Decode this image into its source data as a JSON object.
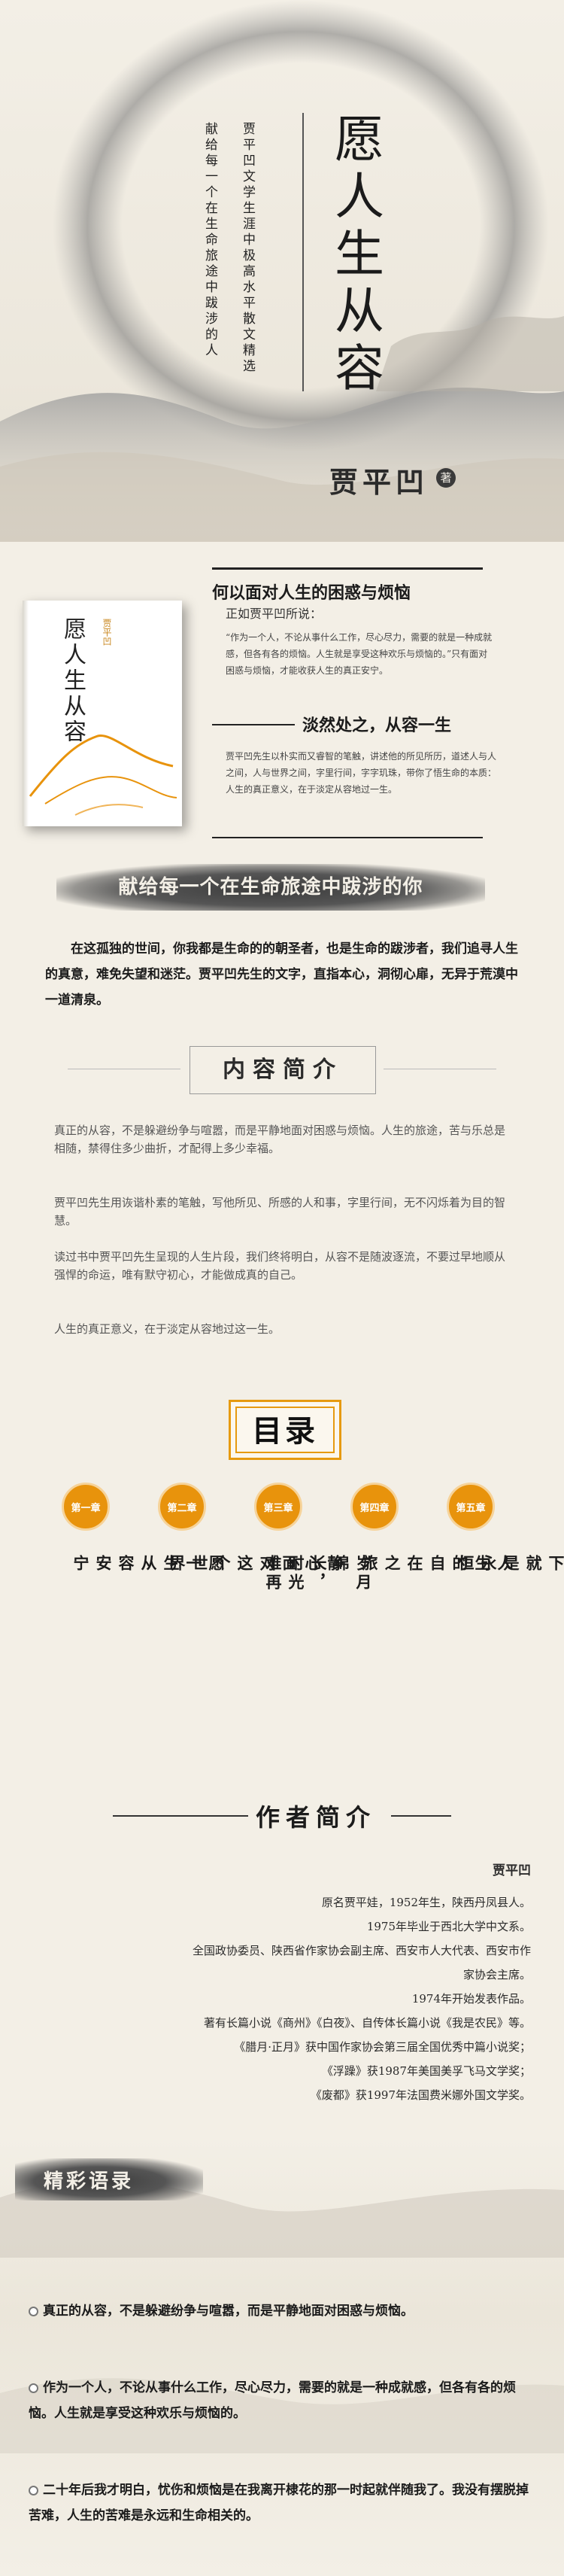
{
  "hero": {
    "title": "愿人生从容",
    "subtitle_1": "贾平凹文学生涯中极高水平散文精选",
    "subtitle_2": "献给每一个在生命旅途中跋涉的人",
    "author": "贾平凹",
    "author_suffix": "著"
  },
  "book": {
    "cover_title": "愿人生从容",
    "cover_author": "贾平凹",
    "question_title": "何以面对人生的困惑与烦恼",
    "question_sub": "正如贾平凹所说：",
    "quote_text": "“作为一个人，不论从事什么工作，尽心尽力，需要的就是一种成就感，但各有各的烦恼。人生就是享受这种欢乐与烦恼的。”只有面对困惑与烦恼，才能收获人生的真正安宁。",
    "answer_title": "淡然处之，从容一生",
    "answer_text": "贾平凹先生以朴实而又睿智的笔触，讲述他的所见所历，道述人与人之间，人与世界之间，字里行间，字字玑珠，带你了悟生命的本质：人生的真正意义，在于淡定从容地过一生。"
  },
  "dedication": {
    "banner": "献给每一个在生命旅途中跋涉的你",
    "paragraph": "在这孤独的世间，你我都是生命的的朝圣者，也是生命的跋涉者，我们追寻人生的真意，难免失望和迷茫。贾平凹先生的文字，直指本心，洞彻心扉，无异于荒漠中一道清泉。"
  },
  "intro": {
    "heading": "内容简介",
    "p1": "真正的从容，不是躲避纷争与喧嚣，而是平静地面对困惑与烦恼。人生的旅途，苦与乐总是相随，禁得住多少曲折，才配得上多少幸福。",
    "p2": "贾平凹先生用诙谐朴素的笔触，写他所见、所感的人和事，字里行间，无不闪烁着为目的智慧。",
    "p3": "读过书中贾平凹先生呈现的人生片段，我们终将明白，从容不是随波逐流，不要过早地顺从强悍的命运，唯有默守初心，才能做成真的自己。",
    "p4": "人生的真正意义，在于淡定从容地过这一生。"
  },
  "toc": {
    "heading": "目录",
    "chapters": [
      {
        "label": "第一章",
        "title": "愿一生从容安宁"
      },
      {
        "label": "第二章",
        "title": "静心面对这个世界"
      },
      {
        "label": "第三章",
        "title": "岁月绵长，时光难再"
      },
      {
        "label": "第四章",
        "title": "人生的自在之旅"
      },
      {
        "label": "第五章",
        "title": "当下就是永恒"
      }
    ]
  },
  "author_intro": {
    "heading": "作者简介",
    "name": "贾平凹",
    "lines": [
      "原名贾平娃，1952年生，陕西丹凤县人。",
      "1975年毕业于西北大学中文系。",
      "全国政协委员、陕西省作家协会副主席、西安市人大代表、西安市作",
      "家协会主席。",
      "1974年开始发表作品。",
      "著有长篇小说《商州》《白夜》、自传体长篇小说《我是农民》等。",
      "《腊月·正月》获中国作家协会第三届全国优秀中篇小说奖；",
      "《浮躁》获1987年美国美孚飞马文学奖；",
      "《废都》获1997年法国费米娜外国文学奖。"
    ]
  },
  "quotes": {
    "heading": "精彩语录",
    "items": [
      "真正的从容，不是躲避纷争与喧嚣，而是平静地面对困惑与烦恼。",
      "作为一个人，不论从事什么工作，尽心尽力，需要的就是一种成就感，但各有各的烦恼。人生就是享受这种欢乐与烦恼的。",
      "二十年后我才明白，忧伤和烦恼是在我离开棣花的那一时起就伴随我了。我没有摆脱掉苦难，人生的苦难是永远和生命相关的。"
    ]
  },
  "colors": {
    "accent": "#e8930c",
    "ink": "#1b1b1b",
    "paper": "#f3efe6"
  }
}
